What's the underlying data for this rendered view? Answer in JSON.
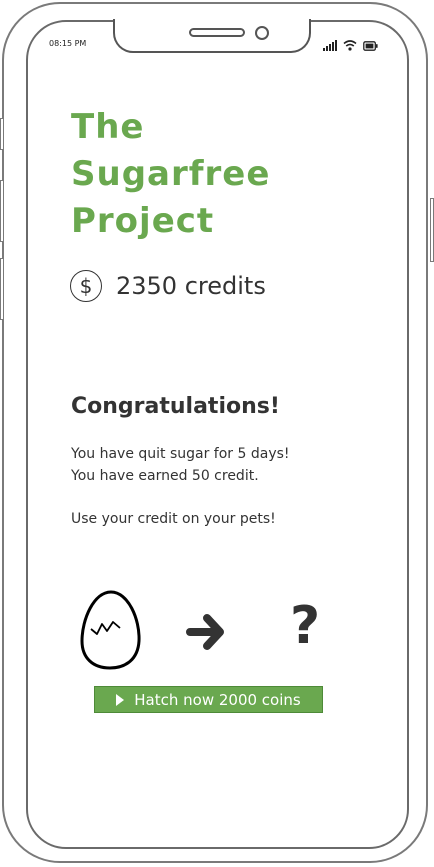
{
  "status_bar": {
    "time": "08:15 PM"
  },
  "app": {
    "title_line1": "The",
    "title_line2": "Sugarfree",
    "title_line3": "Project",
    "title_color": "#6aa84f"
  },
  "credits": {
    "icon": "dollar-coin-icon",
    "text": "2350 credits"
  },
  "congrats": {
    "heading": "Congratulations!",
    "line1": "You have quit sugar for 5 days!",
    "line2": "You have earned 50 credit.",
    "line3": "Use your credit on your pets!"
  },
  "pet": {
    "egg_icon": "cracked-egg-icon",
    "arrow_icon": "arrow-right-icon",
    "mystery_label": "?"
  },
  "hatch_button": {
    "label": "Hatch now 2000 coins",
    "color": "#6aa84f"
  }
}
